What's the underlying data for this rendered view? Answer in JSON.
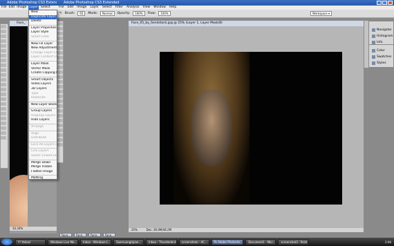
{
  "back_window": {
    "title": "Adobe Photoshop CS3 Extended",
    "menu": [
      "File",
      "Edit",
      "Image",
      "Layer",
      "Select"
    ],
    "doc_tab": "Face_",
    "status": "33.33%"
  },
  "front_window": {
    "title": "Adobe Photoshop CS3 Extended",
    "menu": [
      "File",
      "Edit",
      "Image",
      "Layer",
      "Select",
      "Filter",
      "Analysis",
      "View",
      "Window",
      "Help"
    ]
  },
  "options_bar": {
    "brush_label": "Brush:",
    "brush_size": "65",
    "mode_label": "Mode:",
    "mode_value": "Normal",
    "opacity_label": "Opacity:",
    "opacity_value": "100%",
    "flow_label": "Flow:",
    "flow_value": "100%",
    "workspace": "Workspace ▾"
  },
  "document": {
    "tab": "Face_05_by_Sendstock.jpg @ 25% (Layer 1, Layer Mask/8)",
    "zoom": "25%",
    "doc_info": "Doc: 26.0M/46.2M"
  },
  "panels": {
    "top": [
      "Navigator",
      "Histogram",
      "Info"
    ],
    "bottom": [
      "Color",
      "Swatches",
      "Styles"
    ]
  },
  "layer_menu": [
    {
      "label": "New",
      "disabled": false
    },
    {
      "label": "Duplicate Layer...",
      "disabled": false,
      "highlighted": true
    },
    {
      "label": "Delete",
      "disabled": false
    },
    {
      "sep": true
    },
    {
      "label": "Layer Properties...",
      "disabled": false
    },
    {
      "label": "Layer Style",
      "disabled": false
    },
    {
      "label": "Smart Filter",
      "disabled": true
    },
    {
      "sep": true
    },
    {
      "label": "New Fill Layer",
      "disabled": false
    },
    {
      "label": "New Adjustment Layer",
      "disabled": false
    },
    {
      "label": "Change Layer Content",
      "disabled": true
    },
    {
      "label": "Layer Content Options...",
      "disabled": true
    },
    {
      "sep": true
    },
    {
      "label": "Layer Mask",
      "disabled": false
    },
    {
      "label": "Vector Mask",
      "disabled": false
    },
    {
      "label": "Create Clipping Mask",
      "disabled": false
    },
    {
      "sep": true
    },
    {
      "label": "Smart Objects",
      "disabled": false
    },
    {
      "label": "Video Layers",
      "disabled": false
    },
    {
      "label": "3D Layers",
      "disabled": false
    },
    {
      "label": "Type",
      "disabled": true
    },
    {
      "label": "Rasterize",
      "disabled": true
    },
    {
      "sep": true
    },
    {
      "label": "New Layer Based Slice",
      "disabled": false
    },
    {
      "sep": true
    },
    {
      "label": "Group Layers",
      "disabled": false
    },
    {
      "label": "Ungroup Layers",
      "disabled": true
    },
    {
      "label": "Hide Layers",
      "disabled": false
    },
    {
      "sep": true
    },
    {
      "label": "Arrange",
      "disabled": true
    },
    {
      "sep": true
    },
    {
      "label": "Align",
      "disabled": true
    },
    {
      "label": "Distribute",
      "disabled": true
    },
    {
      "sep": true
    },
    {
      "label": "Lock All Layers in Group...",
      "disabled": true
    },
    {
      "sep": true
    },
    {
      "label": "Link Layers",
      "disabled": true
    },
    {
      "label": "Select Linked Layers",
      "disabled": true
    },
    {
      "sep": true
    },
    {
      "label": "Merge Down",
      "disabled": false
    },
    {
      "label": "Merge Visible",
      "disabled": false
    },
    {
      "label": "Flatten Image",
      "disabled": false
    },
    {
      "sep": true
    },
    {
      "label": "Matting",
      "disabled": false
    }
  ],
  "bottom_docs": [
    "Face...",
    "Face...",
    "Face...",
    "Face..."
  ],
  "taskbar": {
    "tasks": [
      "Y! Yahoo!",
      "Windows Live Me...",
      "Inbox - Windows L...",
      "Sasmuangtipian...",
      "Inbox - Thunderbird",
      "screenshots - AC...",
      "Ps Adobe Photosho...",
      "Document1 - Micr...",
      "screenshot3 - Paint"
    ],
    "active_index": 6,
    "tray": "2:06"
  }
}
